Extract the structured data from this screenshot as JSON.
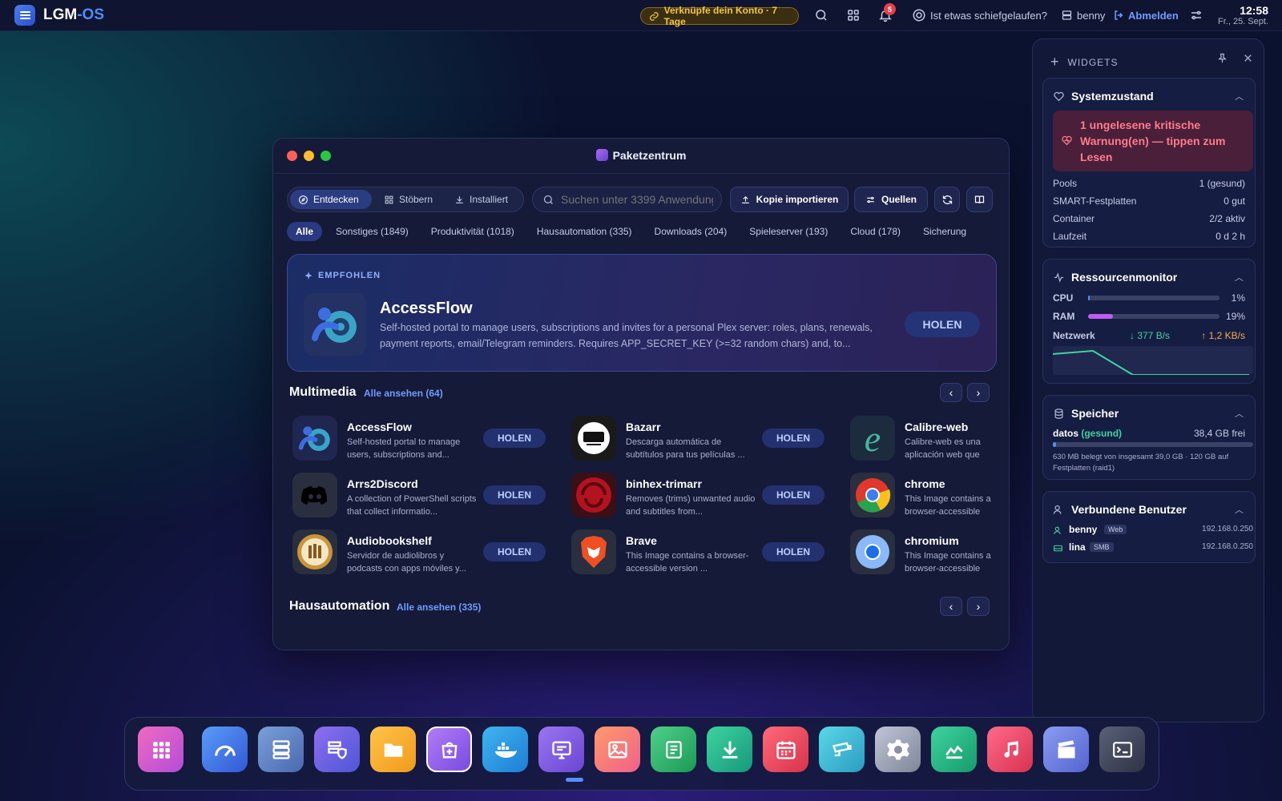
{
  "topbar": {
    "brand_main": "LGM",
    "brand_suffix": "-OS",
    "link_pill": "Verknüpfe dein Konto · 7 Tage",
    "notification_count": "5",
    "help_text": "Ist etwas schiefgelaufen?",
    "user": "benny",
    "logout": "Abmelden",
    "time": "12:58",
    "date": "Fr., 25. Sept."
  },
  "window": {
    "title": "Paketzentrum",
    "tabs": [
      "Entdecken",
      "Stöbern",
      "Installiert"
    ],
    "search_placeholder": "Suchen unter 3399 Anwendungen",
    "import_button": "Kopie importieren",
    "sources_button": "Quellen",
    "categories": [
      "Alle",
      "Sonstiges (1849)",
      "Produktivität (1018)",
      "Hausautomation (335)",
      "Downloads (204)",
      "Spieleserver (193)",
      "Cloud (178)",
      "Sicherung"
    ],
    "featured": {
      "label": "EMPFOHLEN",
      "name": "AccessFlow",
      "description": "Self-hosted portal to manage users, subscriptions and invites for a personal Plex server: roles, plans, renewals, payment reports, email/Telegram reminders. Requires APP_SECRET_KEY (>=32 random chars) and, to...",
      "button": "HOLEN"
    },
    "multimedia": {
      "title": "Multimedia",
      "link": "Alle ansehen (64)",
      "apps": [
        {
          "name": "AccessFlow",
          "desc": "Self-hosted portal to manage users, subscriptions and...",
          "button": "HOLEN"
        },
        {
          "name": "Bazarr",
          "desc": "Descarga automática de subtítulos para tus películas ...",
          "button": "HOLEN"
        },
        {
          "name": "Calibre-web",
          "desc": "Calibre-web es una aplicación web que proporciona...",
          "button": "HOLEN"
        },
        {
          "name": "Arrs2Discord",
          "desc": "A collection of PowerShell scripts that collect informatio...",
          "button": "HOLEN"
        },
        {
          "name": "binhex-trimarr",
          "desc": "Removes (trims) unwanted audio and subtitles from...",
          "button": "HOLEN"
        },
        {
          "name": "chrome",
          "desc": "This Image contains a browser-accessible version...",
          "button": "HOLEN"
        },
        {
          "name": "Audiobookshelf",
          "desc": "Servidor de audiolibros y podcasts con apps móviles y...",
          "button": "HOLEN"
        },
        {
          "name": "Brave",
          "desc": "This Image contains a browser-accessible version ...",
          "button": "HOLEN"
        },
        {
          "name": "chromium",
          "desc": "This Image contains a browser-accessible version...",
          "button": "HOLEN"
        }
      ]
    },
    "hausautomation": {
      "title": "Hausautomation",
      "link": "Alle ansehen (335)"
    }
  },
  "widgets": {
    "header": "WIDGETS",
    "system": {
      "title": "Systemzustand",
      "warning": "1 ungelesene kritische Warnung(en) — tippen zum Lesen",
      "rows": [
        {
          "label": "Pools",
          "value": "1 (gesund)"
        },
        {
          "label": "SMART-Festplatten",
          "value": "0 gut"
        },
        {
          "label": "Container",
          "value": "2/2 aktiv"
        },
        {
          "label": "Laufzeit",
          "value": "0 d 2 h"
        }
      ]
    },
    "resources": {
      "title": "Ressourcenmonitor",
      "cpu_label": "CPU",
      "cpu_value": "1%",
      "cpu_fraction": 0.01,
      "ram_label": "RAM",
      "ram_value": "19%",
      "ram_fraction": 0.19,
      "net_label": "Netzwerk",
      "net_down": "↓ 377 B/s",
      "net_up": "↑ 1,2 KB/s"
    },
    "storage": {
      "title": "Speicher",
      "pool": "datos",
      "pool_state": "(gesund)",
      "free": "38,4 GB frei",
      "used_fraction": 0.016,
      "detail": "630 MB belegt von insgesamt 39,0 GB · 120 GB auf Festplatten (raid1)"
    },
    "users": {
      "title": "Verbundene Benutzer",
      "list": [
        {
          "name": "benny",
          "tag": "Web",
          "ip": "192.168.0.250"
        },
        {
          "name": "lina",
          "tag": "SMB",
          "ip": "192.168.0.250"
        }
      ]
    }
  },
  "colors": {
    "accent": "#4f8df5",
    "warning": "#ff7b88",
    "healthy": "#3ed3a0",
    "ram": "#c05cf0"
  }
}
